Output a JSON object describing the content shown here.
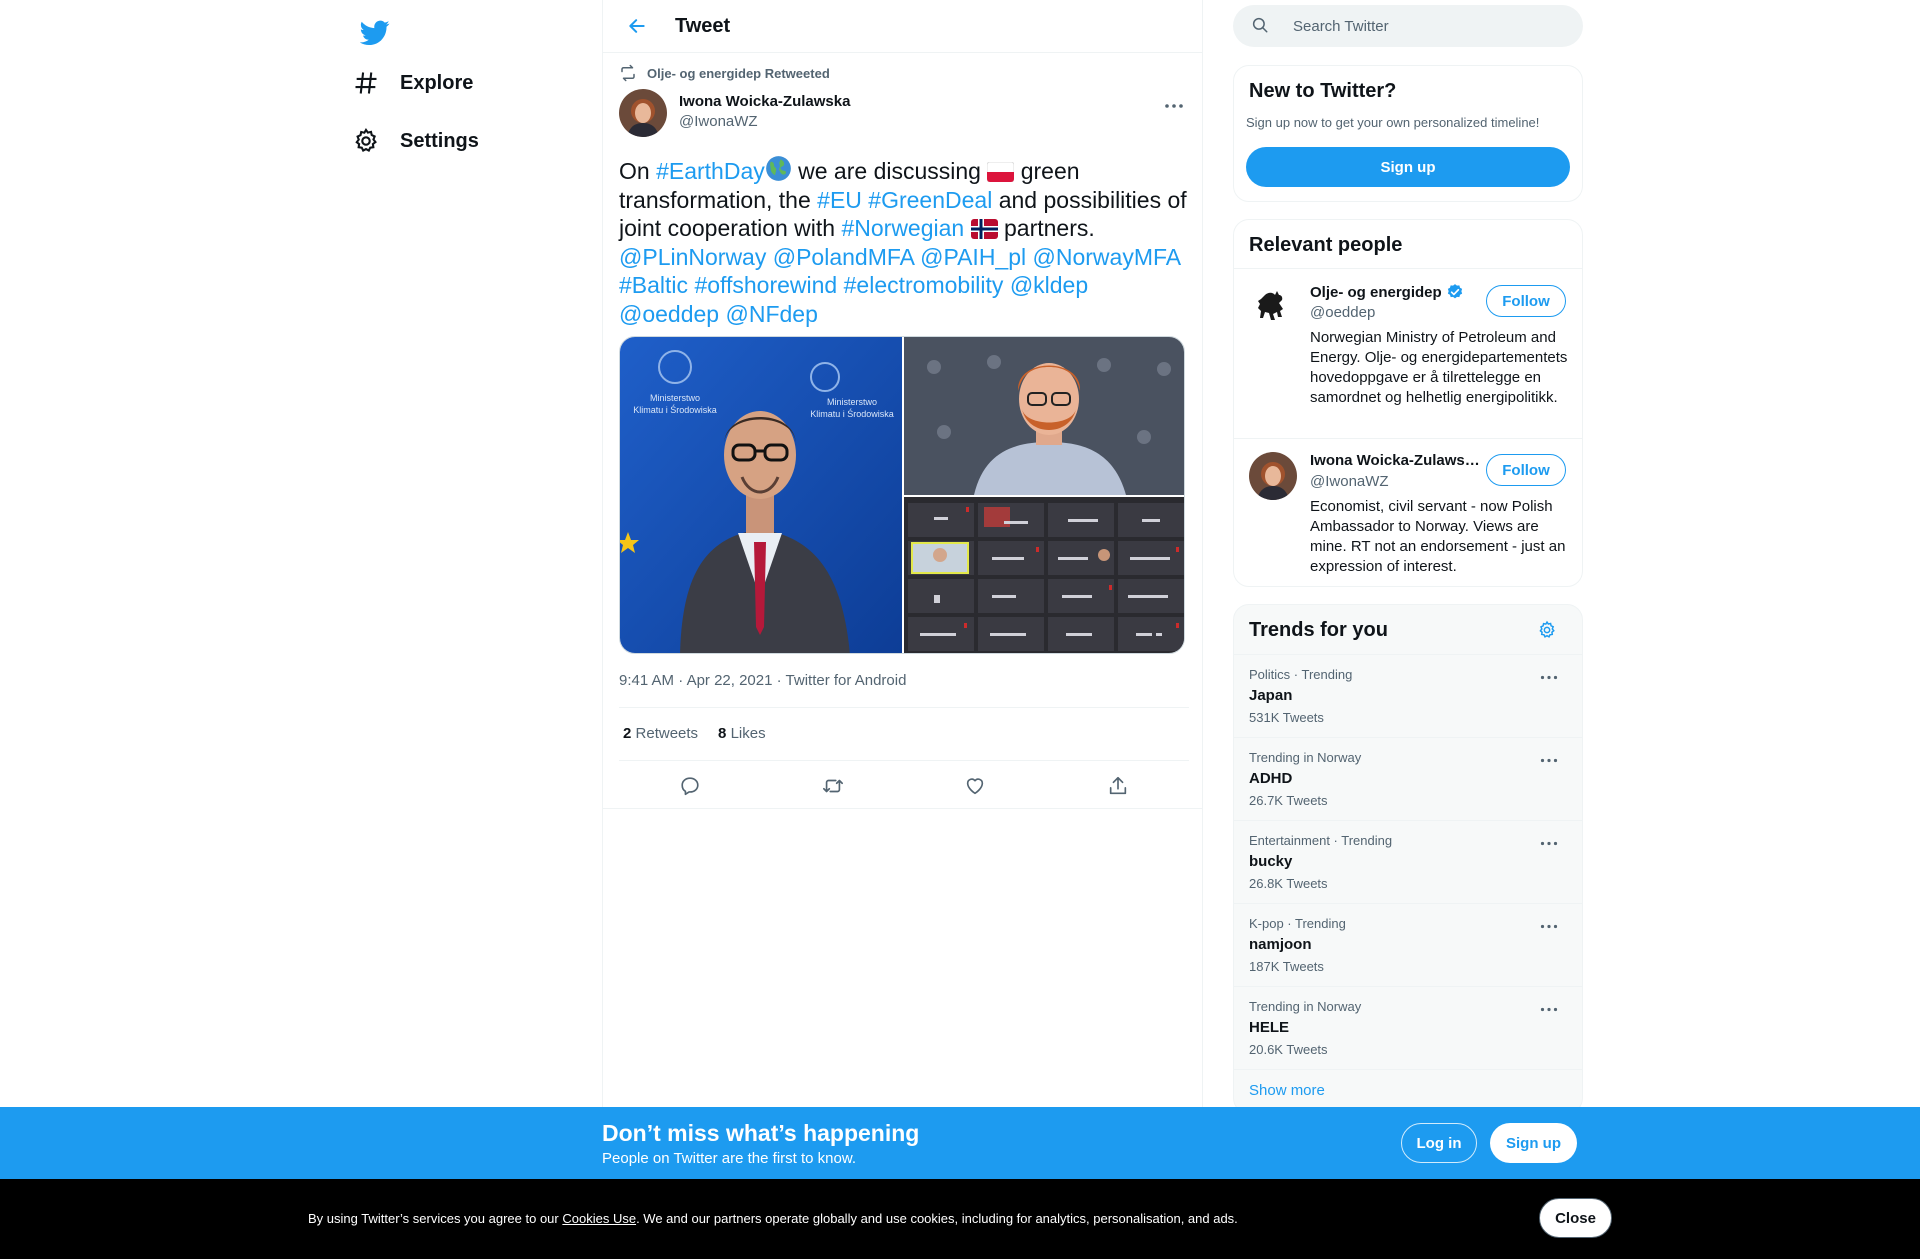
{
  "nav": {
    "explore_label": "Explore",
    "settings_label": "Settings"
  },
  "header": {
    "title": "Tweet"
  },
  "tweet": {
    "retweeted_by": "Olje- og energidep Retweeted",
    "author_name": "Iwona Woicka-Zulawska",
    "author_handle": "@IwonaWZ",
    "text_parts": {
      "p1": "On ",
      "tag_earthday": "#EarthDay",
      "p2": " we are discussing ",
      "p3": " green transformation, the ",
      "tag_eu": "#EU",
      "tag_greendeal": "#GreenDeal",
      "p4": " and possibilities of joint cooperation with ",
      "tag_norwegian": "#Norwegian",
      "p5": " partners. ",
      "m_plinnorway": "@PLinNorway",
      "m_polandmfa": "@PolandMFA",
      "m_paih": "@PAIH_pl",
      "m_norwaymfa": "@NorwayMFA",
      "tag_baltic": "#Baltic",
      "tag_offshorewind": "#offshorewind",
      "tag_electromobility": "#electromobility",
      "m_kldep": "@kldep",
      "m_oeddep": "@oeddep",
      "m_nfdep": "@NFdep"
    },
    "media_text": {
      "sign_line1": "Ministerstwo",
      "sign_line2": "Klimatu i Środowiska",
      "sign2_line1": "Ministerstwo",
      "sign2_line2": "Klimatu i Środowiska"
    },
    "time": "9:41 AM",
    "date": "Apr 22, 2021",
    "source": "Twitter for Android",
    "retweets_count": "2",
    "retweets_label": "Retweets",
    "likes_count": "8",
    "likes_label": "Likes"
  },
  "search": {
    "placeholder": "Search Twitter"
  },
  "new_to_twitter": {
    "title": "New to Twitter?",
    "subtitle": "Sign up now to get your own personalized timeline!",
    "signup_label": "Sign up"
  },
  "relevant_people": {
    "title": "Relevant people",
    "people": [
      {
        "name": "Olje- og energidep",
        "handle": "@oeddep",
        "bio": "Norwegian Ministry of Petroleum and Energy. Olje- og energidepartementets hovedoppgave er å tilrettelegge en samordnet og helhetlig energipolitikk.",
        "follow_label": "Follow"
      },
      {
        "name": "Iwona Woicka-Zulawska",
        "handle": "@IwonaWZ",
        "bio": "Economist, civil servant - now Polish Ambassador to Norway. Views are mine. RT not an endorsement - just an expression of interest.",
        "follow_label": "Follow"
      }
    ]
  },
  "trends": {
    "title": "Trends for you",
    "items": [
      {
        "meta": "Politics · Trending",
        "name": "Japan",
        "count": "531K Tweets"
      },
      {
        "meta": "Trending in Norway",
        "name": "ADHD",
        "count": "26.7K Tweets"
      },
      {
        "meta": "Entertainment · Trending",
        "name": "bucky",
        "count": "26.8K Tweets"
      },
      {
        "meta": "K-pop · Trending",
        "name": "namjoon",
        "count": "187K Tweets"
      },
      {
        "meta": "Trending in Norway",
        "name": "HELE",
        "count": "20.6K Tweets"
      }
    ],
    "show_more": "Show more"
  },
  "banner": {
    "title": "Don’t miss what’s happening",
    "subtitle": "People on Twitter are the first to know.",
    "login_label": "Log in",
    "signup_label": "Sign up"
  },
  "cookie": {
    "text_before": "By using Twitter’s services you agree to our ",
    "link_label": "Cookies Use",
    "text_after": ". We and our partners operate globally and use cookies, including for analytics, personalisation, and ads.",
    "close_label": "Close"
  },
  "colors": {
    "accent": "#1d9bf0",
    "text": "#0f1419",
    "secondary": "#536471"
  }
}
